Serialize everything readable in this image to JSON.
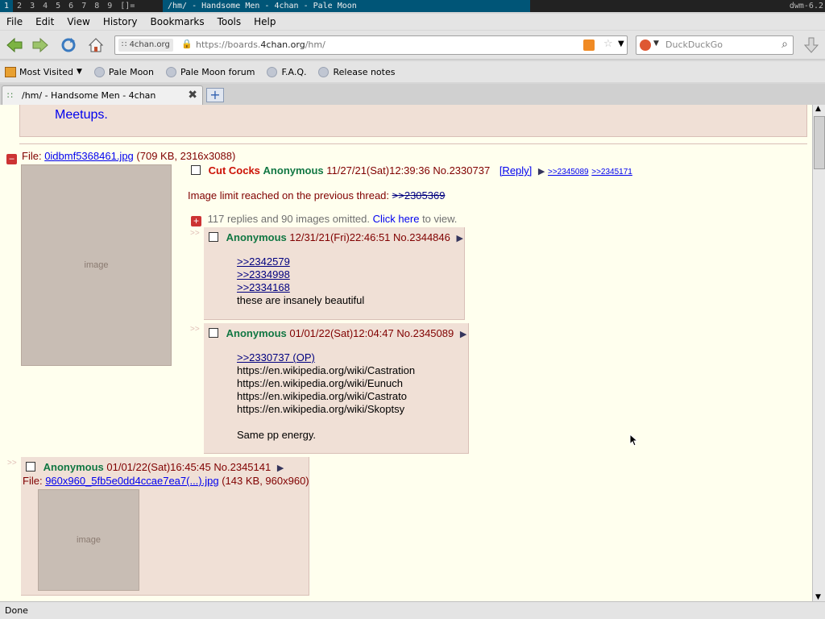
{
  "wm": {
    "tags": [
      "1",
      "2",
      "3",
      "4",
      "5",
      "6",
      "7",
      "8",
      "9"
    ],
    "layout": "[]=",
    "title": "/hm/ - Handsome Men - 4chan - Pale Moon",
    "status": "dwm-6.2"
  },
  "menu": [
    "File",
    "Edit",
    "View",
    "History",
    "Bookmarks",
    "Tools",
    "Help"
  ],
  "nav": {
    "site_badge": "4chan.org",
    "url_prefix": "https://boards.",
    "url_domain": "4chan.org",
    "url_suffix": "/hm/",
    "search_placeholder": "DuckDuckGo"
  },
  "bookmarks": [
    "Most Visited",
    "Pale Moon",
    "Pale Moon forum",
    "F.A.Q.",
    "Release notes"
  ],
  "tab": {
    "title": "/hm/ - Handsome Men - 4chan"
  },
  "page": {
    "meetups": "Meetups.",
    "op": {
      "file_label": "File:",
      "file_name": "0idbmf5368461.jpg",
      "file_info": "(709 KB, 2316x3088)",
      "subject": "Cut Cocks",
      "name": "Anonymous",
      "datetime": "11/27/21(Sat)12:39:36",
      "number": "No.2330737",
      "reply_link": "[Reply]",
      "backlinks": [
        ">>2345089",
        ">>2345171"
      ],
      "notice": "Image limit reached on the previous thread:",
      "notice_link": ">>2305369",
      "omitted": "117 replies and 90 images omitted.",
      "click_here": "Click here",
      "to_view": "to view."
    },
    "replies": [
      {
        "name": "Anonymous",
        "datetime": "12/31/21(Fri)22:46:51",
        "number": "No.2344846",
        "quotes": [
          ">>2342579",
          ">>2334998",
          ">>2334168"
        ],
        "text": [
          "these are insanely beautiful"
        ]
      },
      {
        "name": "Anonymous",
        "datetime": "01/01/22(Sat)12:04:47",
        "number": "No.2345089",
        "quotes": [
          ">>2330737 (OP)"
        ],
        "text": [
          "https://en.wikipedia.org/wiki/Castration",
          "https://en.wikipedia.org/wiki/Eunuch",
          "https://en.wikipedia.org/wiki/Castrato",
          "https://en.wikipedia.org/wiki/Skoptsy",
          "",
          "Same pp energy."
        ]
      },
      {
        "name": "Anonymous",
        "datetime": "01/01/22(Sat)16:45:45",
        "number": "No.2345141",
        "file_label": "File:",
        "file_name": "960x960_5fb5e0dd4ccae7ea7(...).jpg",
        "file_info": "(143 KB, 960x960)"
      }
    ],
    "side_arrows": ">>"
  },
  "status": "Done"
}
